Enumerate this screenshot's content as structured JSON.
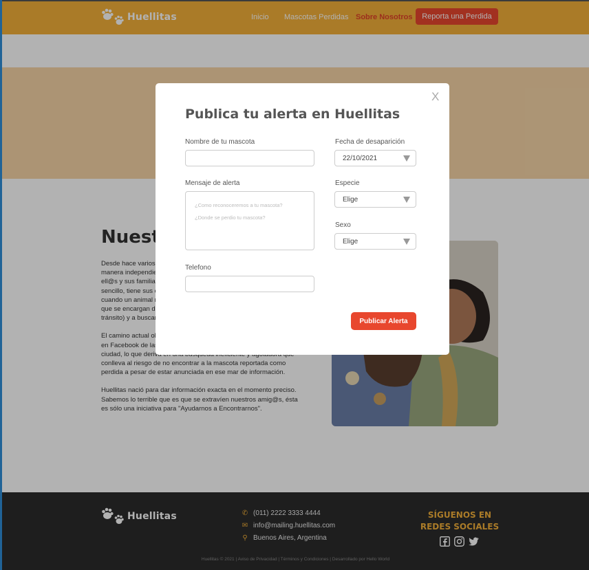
{
  "brand": {
    "name": "Huellitas"
  },
  "nav": {
    "inicio": "Inicio",
    "mascotas_perdidas": "Mascotas Perdidas",
    "sobre_nosotros": "Sobre Nosotros",
    "reporta_button": "Reporta una Perdida"
  },
  "about": {
    "title_partial": "Nuestro",
    "paragraphs": [
      "Desde hace varios años diferentes organizaciones y rescatistas de manera independiente tratan de ayudar y hacer llegar historias de ell@s y sus familias. Es un mundo muy grande que, aunque parece sencillo, tiene sus complicaciones. Los animalistas lo saben, por eso cuando un animal necesita ayuda encontramos una red de personas que se encargan de ayudar (proveyendo salud, alimento, hogares de tránsito) y a buscar a su familia.",
      "El camino actual obliga a las personas a buscar en distintas páginas en Facebook de las diferentes asociaciones y rescatistas de la ciudad, lo que deriva en una búsqueda ineficiente y agotadora que conlleva al riesgo de no encontrar a la mascota reportada como perdida a pesar de estar anunciada en ese mar de información.",
      "Huellitas nació para dar información exacta en el momento preciso. Sabemos lo terrible que es que se extravíen nuestros amig@s, ésta es sólo una iniciativa para \"Ayudarnos a Encontrarnos\"."
    ]
  },
  "footer": {
    "phone": "(011) 2222 3333 4444",
    "email": "info@mailing.huellitas.com",
    "location": "Buenos Aires, Argentina",
    "social_title": "SÍGUENOS EN REDES SOCIALES",
    "copyright": "Huellitas © 2021 | Aviso de Privacidad | Términos y Condiciones | Desarrollado por Hello World"
  },
  "modal": {
    "close": "X",
    "title": "Publica tu alerta en Huellitas",
    "nombre_label": "Nombre de tu mascota",
    "nombre_value": "",
    "fecha_label": "Fecha de desaparición",
    "fecha_value": "22/10/2021",
    "mensaje_label": "Mensaje de alerta",
    "mensaje_placeholder_1": "¿Como reconoceremos a tu mascota?",
    "mensaje_placeholder_2": "¿Donde se perdio tu mascota?",
    "especie_label": "Especie",
    "especie_value": "Elige",
    "sexo_label": "Sexo",
    "sexo_value": "Elige",
    "telefono_label": "Telefono",
    "telefono_value": "",
    "submit": "Publicar Alerta"
  },
  "colors": {
    "header": "#f4b13a",
    "accent": "#e8472e",
    "hero": "#f7d5a7",
    "footer": "#2b2b2b"
  },
  "icons": {
    "logo": "paw-icon",
    "phone": "phone-icon",
    "email": "mail-icon",
    "location": "pin-icon",
    "facebook": "facebook-icon",
    "instagram": "instagram-icon",
    "twitter": "twitter-icon",
    "select_arrow": "caret-down-icon"
  }
}
